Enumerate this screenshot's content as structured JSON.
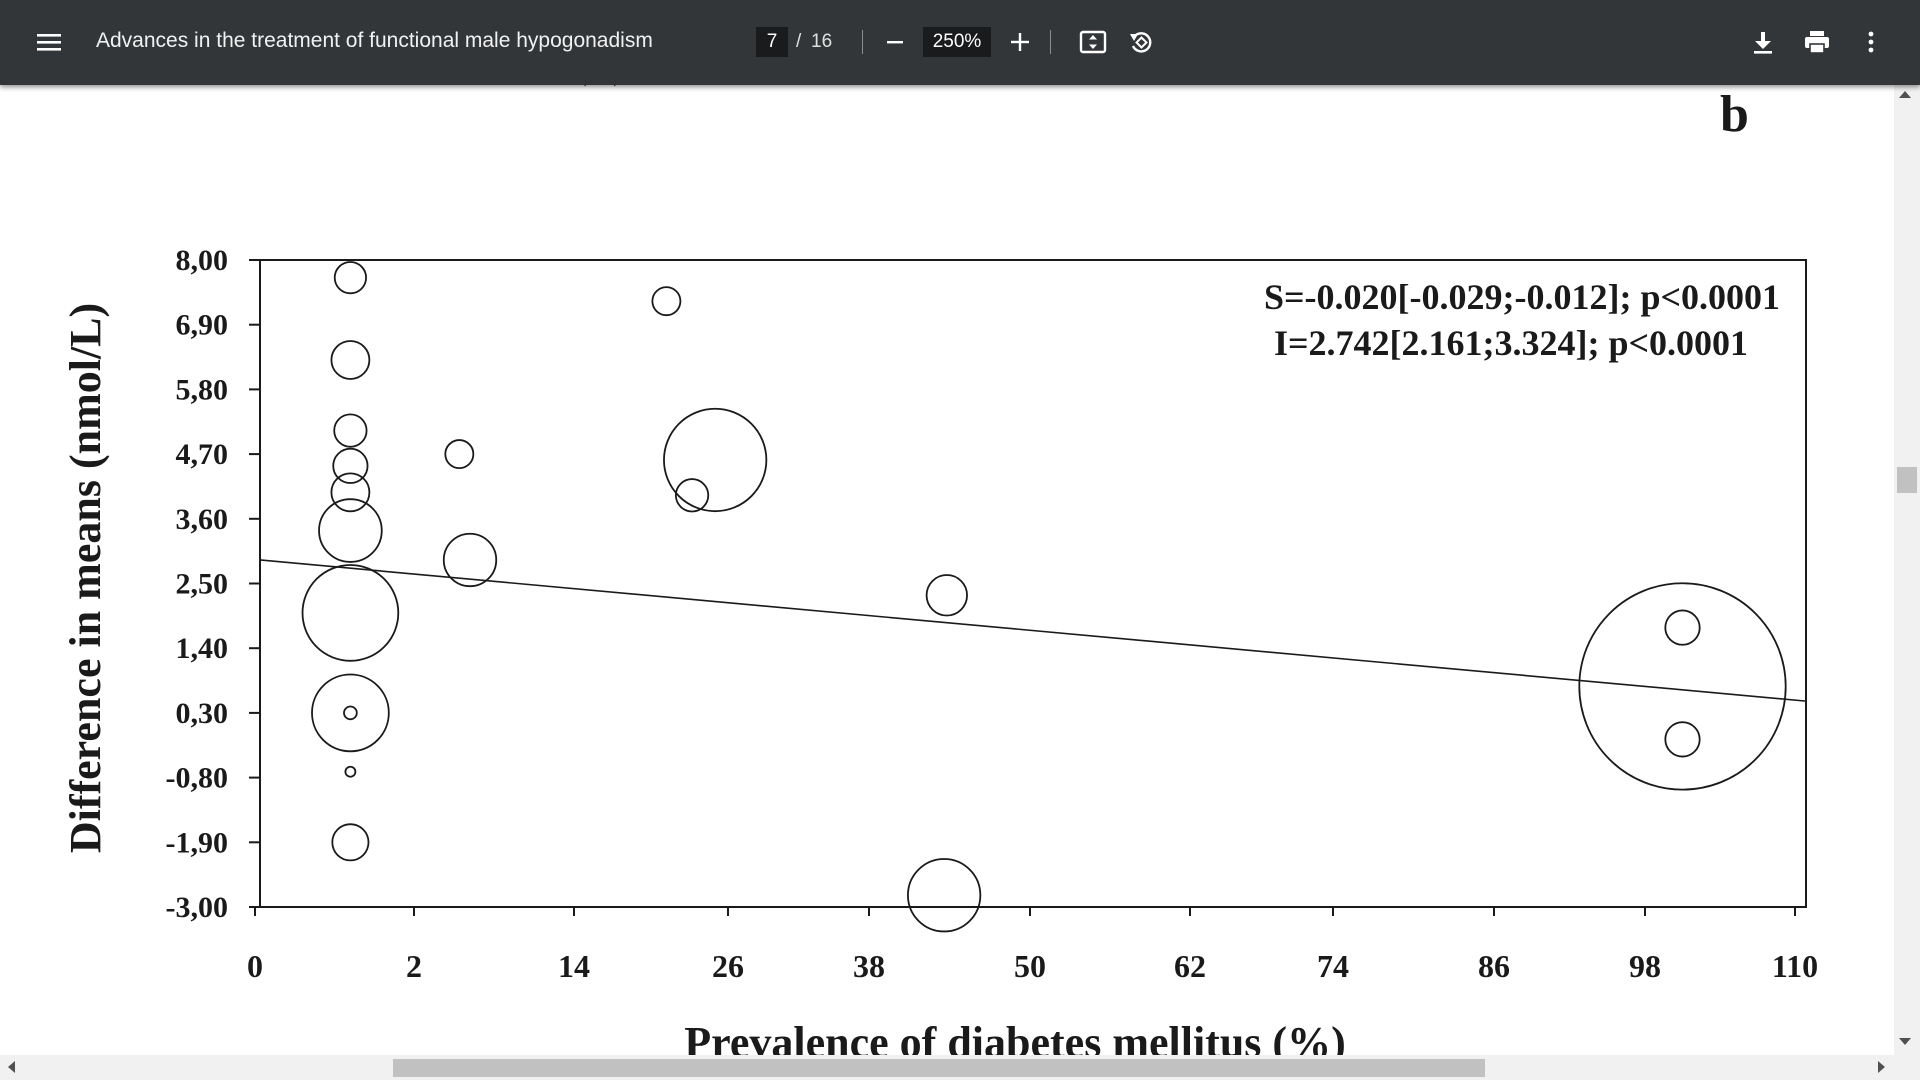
{
  "toolbar": {
    "menu_icon": "hamburger-menu-icon",
    "title": "Advances in the treatment of functional male hypogonadism",
    "page_current": "7",
    "page_separator": "/",
    "page_total": "16",
    "zoom_level": "250%",
    "icons": {
      "zoom_out": "minus-icon",
      "zoom_in": "plus-icon",
      "fit": "fit-to-page-icon",
      "rotate": "rotate-icon",
      "download": "download-icon",
      "print": "print-icon",
      "more": "more-vertical-icon"
    },
    "background": "#323639"
  },
  "document": {
    "top_cut_marks": "-/  ~ (  ~)",
    "panel_label": "b",
    "chart_data": {
      "type": "scatter",
      "title": "",
      "xlabel": "Prevalence of diabetes mellitus (%)",
      "ylabel": "Difference in means (nmol/L)",
      "x_ticks": [
        "0",
        "2",
        "14",
        "26",
        "38",
        "50",
        "62",
        "74",
        "86",
        "98",
        "110"
      ],
      "y_ticks": [
        "8,00",
        "6,90",
        "5,80",
        "4,70",
        "3,60",
        "2,50",
        "1,40",
        "0,30",
        "-0,80",
        "-1,90",
        "-3,00"
      ],
      "ylim": [
        -3.0,
        8.0
      ],
      "grid": false,
      "annotations": [
        "S=-0.020[-0.029;-0.012]; p<0.0001",
        "I=2.742[2.161;3.324]; p<0.0001"
      ],
      "points": [
        {
          "x": 1.2,
          "y": 7.7,
          "weight": 1.5
        },
        {
          "x": 1.2,
          "y": 6.3,
          "weight": 2.2
        },
        {
          "x": 1.2,
          "y": 5.1,
          "weight": 1.6
        },
        {
          "x": 1.2,
          "y": 4.5,
          "weight": 1.8
        },
        {
          "x": 1.2,
          "y": 4.05,
          "weight": 2.2
        },
        {
          "x": 1.2,
          "y": 3.4,
          "weight": 6
        },
        {
          "x": 1.2,
          "y": 2.0,
          "weight": 14
        },
        {
          "x": 1.2,
          "y": 0.3,
          "weight": 9
        },
        {
          "x": 1.2,
          "y": 0.3,
          "weight": 0.25
        },
        {
          "x": 1.2,
          "y": -0.7,
          "weight": 0.15
        },
        {
          "x": 1.2,
          "y": -1.9,
          "weight": 2
        },
        {
          "x": 5.4,
          "y": 4.7,
          "weight": 1.2
        },
        {
          "x": 6.2,
          "y": 2.9,
          "weight": 4.2
        },
        {
          "x": 21.2,
          "y": 7.3,
          "weight": 1.2
        },
        {
          "x": 23.2,
          "y": 4.0,
          "weight": 1.6
        },
        {
          "x": 25.0,
          "y": 4.6,
          "weight": 16
        },
        {
          "x": 43.8,
          "y": 2.3,
          "weight": 2.5
        },
        {
          "x": 43.6,
          "y": -2.8,
          "weight": 8
        },
        {
          "x": 101.0,
          "y": 1.75,
          "weight": 1.8
        },
        {
          "x": 101.0,
          "y": -0.15,
          "weight": 1.8
        },
        {
          "x": 101.0,
          "y": 0.75,
          "weight": 65
        }
      ],
      "regression_line": {
        "x": [
          0,
          110
        ],
        "y": [
          2.9,
          0.5
        ]
      }
    }
  }
}
